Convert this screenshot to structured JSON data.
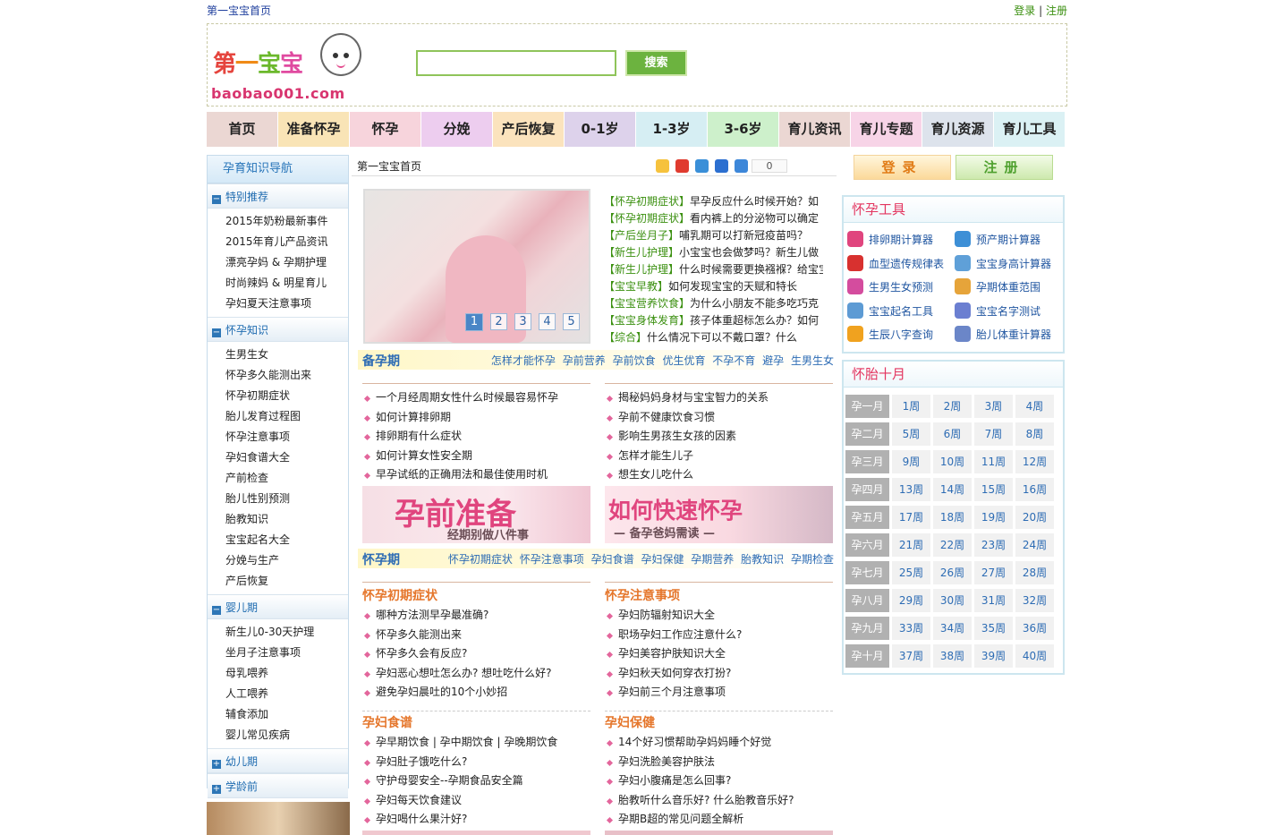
{
  "topbar": {
    "home": "第一宝宝首页",
    "login": "登录",
    "sep": "|",
    "register": "注册"
  },
  "logo": {
    "cn": [
      "第",
      "一",
      "宝",
      "宝"
    ],
    "en": "baobao001.com"
  },
  "search": {
    "placeholder": "",
    "button": "搜索"
  },
  "nav": [
    {
      "label": "首页",
      "bg": "#ebd7d3"
    },
    {
      "label": "准备怀孕",
      "bg": "#f9e4b6"
    },
    {
      "label": "怀孕",
      "bg": "#f7d4dc"
    },
    {
      "label": "分娩",
      "bg": "#edcdef"
    },
    {
      "label": "产后恢复",
      "bg": "#fbe3bd"
    },
    {
      "label": "0-1岁",
      "bg": "#ddd2eb"
    },
    {
      "label": "1-3岁",
      "bg": "#d6eef3"
    },
    {
      "label": "3-6岁",
      "bg": "#cdf0cb"
    },
    {
      "label": "育儿资讯",
      "bg": "#ebd7d3"
    },
    {
      "label": "育儿专题",
      "bg": "#f7d4e7"
    },
    {
      "label": "育儿资源",
      "bg": "#dde3ec"
    },
    {
      "label": "育儿工具",
      "bg": "#dbf1f4"
    }
  ],
  "sidebar": {
    "title": "孕育知识导航",
    "groups": [
      {
        "head": "特别推荐",
        "icon": "minus-icon",
        "items": [
          "2015年奶粉最新事件",
          "2015年育儿产品资讯",
          "漂亮孕妈 & 孕期护理",
          "时尚辣妈 & 明星育儿",
          "孕妇夏天注意事项"
        ]
      },
      {
        "head": "怀孕知识",
        "icon": "minus-icon",
        "items": [
          "生男生女",
          "怀孕多久能测出来",
          "怀孕初期症状",
          "胎儿发育过程图",
          "怀孕注意事项",
          "孕妇食谱大全",
          "产前检查",
          "胎儿性别预测",
          "胎教知识",
          "宝宝起名大全",
          "分娩与生产",
          "产后恢复"
        ]
      },
      {
        "head": "婴儿期",
        "icon": "minus-icon",
        "items": [
          "新生儿0-30天护理",
          "坐月子注意事项",
          "母乳喂养",
          "人工喂养",
          "辅食添加",
          "婴儿常见疾病"
        ]
      },
      {
        "head": "幼儿期",
        "icon": "plus-icon",
        "items": []
      },
      {
        "head": "学龄前",
        "icon": "plus-icon",
        "items": []
      }
    ]
  },
  "crumb": "第一宝宝首页",
  "share": {
    "count": "0",
    "icons": [
      "qzone-icon",
      "weibo-icon",
      "pengyou-icon",
      "baidu-icon",
      "more-icon"
    ]
  },
  "slider": {
    "pages": [
      "1",
      "2",
      "3",
      "4",
      "5"
    ],
    "active": 0
  },
  "headlines": [
    {
      "tag": "【怀孕初期症状】",
      "text": "早孕反应什么时候开始？如"
    },
    {
      "tag": "【怀孕初期症状】",
      "text": "看内裤上的分泌物可以确定"
    },
    {
      "tag": "【产后坐月子】",
      "text": "哺乳期可以打新冠疫苗吗？"
    },
    {
      "tag": "【新生儿护理】",
      "text": "小宝宝也会做梦吗？新生儿做"
    },
    {
      "tag": "【新生儿护理】",
      "text": "什么时候需要更换襁褓？给宝宝"
    },
    {
      "tag": "【宝宝早教】",
      "text": "如何发现宝宝的天赋和特长"
    },
    {
      "tag": "【宝宝营养饮食】",
      "text": "为什么小朋友不能多吃巧克"
    },
    {
      "tag": "【宝宝身体发育】",
      "text": "孩子体重超标怎么办？如何"
    },
    {
      "tag": "【综合】",
      "text": "什么情况下可以不戴口罩？什么"
    }
  ],
  "beiyun": {
    "title": "备孕期",
    "links": [
      "怎样才能怀孕",
      "孕前营养",
      "孕前饮食",
      "优生优育",
      "不孕不育",
      "避孕",
      "生男生女"
    ],
    "left": [
      "一个月经周期女性什么时候最容易怀孕",
      "如何计算排卵期",
      "排卵期有什么症状",
      "如何计算女性安全期",
      "早孕试纸的正确用法和最佳使用时机"
    ],
    "right": [
      "揭秘妈妈身材与宝宝智力的关系",
      "孕前不健康饮食习惯",
      "影响生男孩生女孩的因素",
      "怎样才能生儿子",
      "想生女儿吃什么"
    ],
    "banner1": {
      "big": "孕前准备",
      "small": "经期别做八件事"
    },
    "banner2": {
      "big": "如何快速怀孕",
      "small": "— 备孕爸妈需读 —"
    }
  },
  "huaiyun": {
    "title": "怀孕期",
    "links": [
      "怀孕初期症状",
      "怀孕注意事项",
      "孕妇食谱",
      "孕妇保健",
      "孕期营养",
      "胎教知识",
      "孕期检查"
    ],
    "block1": {
      "left_title": "怀孕初期症状",
      "left": [
        "哪种方法测早孕最准确?",
        "怀孕多久能测出来",
        "怀孕多久会有反应?",
        "孕妇恶心想吐怎么办? 想吐吃什么好?",
        "避免孕妇晨吐的10个小妙招"
      ],
      "right_title": "怀孕注意事项",
      "right": [
        "孕妇防辐射知识大全",
        "职场孕妇工作应注意什么?",
        "孕妇美容护肤知识大全",
        "孕妇秋天如何穿衣打扮?",
        "孕妇前三个月注意事项"
      ]
    },
    "block2": {
      "left_title": "孕妇食谱",
      "left": [
        "孕早期饮食 | 孕中期饮食 | 孕晚期饮食",
        "孕妇肚子饿吃什么?",
        "守护母婴安全--孕期食品安全篇",
        "孕妇每天饮食建议",
        "孕妇喝什么果汁好?"
      ],
      "right_title": "孕妇保健",
      "right": [
        "14个好习惯帮助孕妈妈睡个好觉",
        "孕妇洗脸美容护肤法",
        "孕妇小腹痛是怎么回事?",
        "胎教听什么音乐好? 什么胎教音乐好?",
        "孕期B超的常见问题全解析"
      ]
    }
  },
  "account": {
    "login": "登录",
    "register": "注册"
  },
  "tools": {
    "title": "怀孕工具",
    "items": [
      {
        "label": "排卵期计算器",
        "icon": "heart-icon",
        "color": "#e0457e"
      },
      {
        "label": "预产期计算器",
        "icon": "clock-icon",
        "color": "#3d8fd6"
      },
      {
        "label": "血型遗传规律表",
        "icon": "blood-icon",
        "color": "#d8312f"
      },
      {
        "label": "宝宝身高计算器",
        "icon": "ruler-icon",
        "color": "#5fa0d8"
      },
      {
        "label": "生男生女预测",
        "icon": "gender-icon",
        "color": "#d44c9e"
      },
      {
        "label": "孕期体重范围",
        "icon": "scale-icon",
        "color": "#e6a43a"
      },
      {
        "label": "宝宝起名工具",
        "icon": "name-icon",
        "color": "#5d9bd4"
      },
      {
        "label": "宝宝名字测试",
        "icon": "test-icon",
        "color": "#6b7fd1"
      },
      {
        "label": "生辰八字查询",
        "icon": "moon-icon",
        "color": "#f0a21f"
      },
      {
        "label": "胎儿体重计算器",
        "icon": "baby-weight-icon",
        "color": "#6b86c8"
      }
    ]
  },
  "pregnancy": {
    "title": "怀胎十月",
    "months": [
      {
        "m": "孕一月",
        "w": [
          "1周",
          "2周",
          "3周",
          "4周"
        ]
      },
      {
        "m": "孕二月",
        "w": [
          "5周",
          "6周",
          "7周",
          "8周"
        ]
      },
      {
        "m": "孕三月",
        "w": [
          "9周",
          "10周",
          "11周",
          "12周"
        ]
      },
      {
        "m": "孕四月",
        "w": [
          "13周",
          "14周",
          "15周",
          "16周"
        ]
      },
      {
        "m": "孕五月",
        "w": [
          "17周",
          "18周",
          "19周",
          "20周"
        ]
      },
      {
        "m": "孕六月",
        "w": [
          "21周",
          "22周",
          "23周",
          "24周"
        ]
      },
      {
        "m": "孕七月",
        "w": [
          "25周",
          "26周",
          "27周",
          "28周"
        ]
      },
      {
        "m": "孕八月",
        "w": [
          "29周",
          "30周",
          "31周",
          "32周"
        ]
      },
      {
        "m": "孕九月",
        "w": [
          "33周",
          "34周",
          "35周",
          "36周"
        ]
      },
      {
        "m": "孕十月",
        "w": [
          "37周",
          "38周",
          "39周",
          "40周"
        ]
      }
    ]
  }
}
